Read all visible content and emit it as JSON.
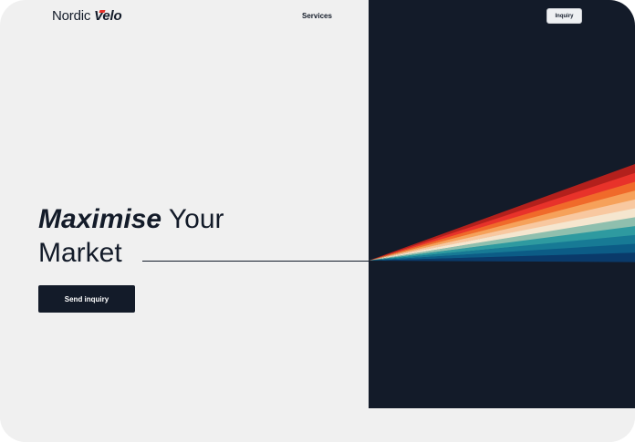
{
  "header": {
    "logo_part1": "Nordic",
    "logo_part2": "Velo",
    "nav_services": "Services",
    "inquiry_button": "Inquiry"
  },
  "hero": {
    "headline_em": "Maximise",
    "headline_rest": "Your",
    "headline_line2": "Market",
    "cta_label": "Send inquiry"
  },
  "colors": {
    "dark": "#131b29",
    "background": "#f0f0f0",
    "fan": [
      "#b3201c",
      "#e8322a",
      "#f06a2a",
      "#f6a15a",
      "#f8c8a0",
      "#f5e6cf",
      "#8fbfae",
      "#2e9aa0",
      "#177a95",
      "#0c5c86",
      "#0a3a6a"
    ]
  }
}
